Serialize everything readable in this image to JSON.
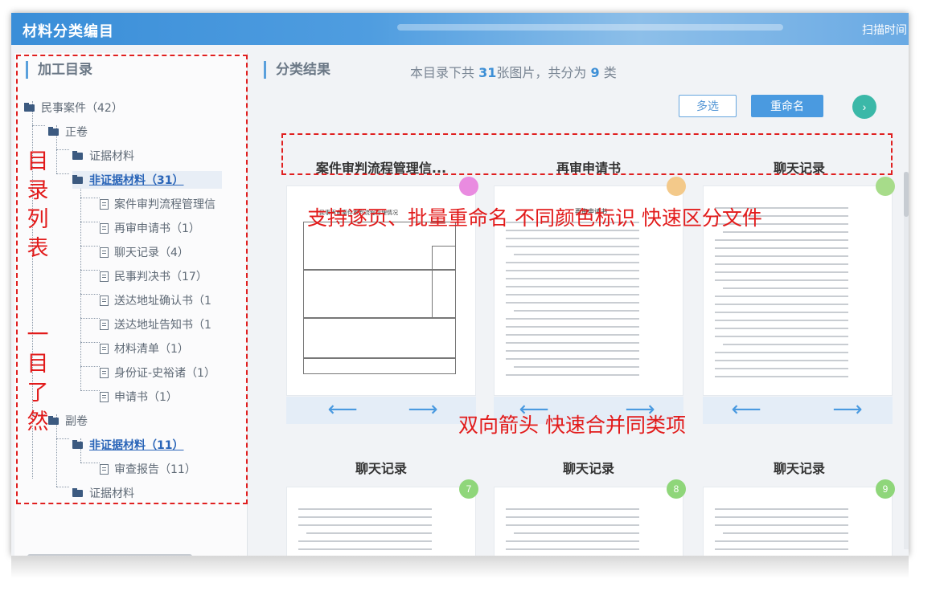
{
  "app": {
    "title": "材料分类编目",
    "scan_time_label": "扫描时间"
  },
  "sidebar": {
    "header": "加工目录",
    "tree": [
      {
        "label": "民事案件（42）",
        "type": "folder",
        "level": 0
      },
      {
        "label": "正卷",
        "type": "folder",
        "level": 1
      },
      {
        "label": "证据材料",
        "type": "folder",
        "level": 2
      },
      {
        "label": "非证据材料（31）",
        "type": "folder",
        "level": 2,
        "selected": true
      },
      {
        "label": "案件审判流程管理信",
        "type": "doc",
        "level": 3
      },
      {
        "label": "再审申请书（1）",
        "type": "doc",
        "level": 3
      },
      {
        "label": "聊天记录（4）",
        "type": "doc",
        "level": 3
      },
      {
        "label": "民事判决书（17）",
        "type": "doc",
        "level": 3
      },
      {
        "label": "送达地址确认书（1",
        "type": "doc",
        "level": 3
      },
      {
        "label": "送达地址告知书（1",
        "type": "doc",
        "level": 3
      },
      {
        "label": "材料清单（1）",
        "type": "doc",
        "level": 3
      },
      {
        "label": "身份证-史裕诸（1）",
        "type": "doc",
        "level": 3
      },
      {
        "label": "申请书（1）",
        "type": "doc",
        "level": 3
      },
      {
        "label": "副卷",
        "type": "folder",
        "level": 1
      },
      {
        "label": "非证据材料（11）",
        "type": "folder",
        "level": 2,
        "selected": true
      },
      {
        "label": "审查报告（11）",
        "type": "doc",
        "level": 3
      },
      {
        "label": "证据材料",
        "type": "folder",
        "level": 2
      }
    ]
  },
  "main": {
    "header": "分类结果",
    "summary_prefix": "本目录下共",
    "summary_count": "31",
    "summary_mid": "张图片，共分为",
    "summary_classes": "9",
    "summary_suffix": "类",
    "btn_multi": "多选",
    "btn_rename": "重命名",
    "btn_next": "›",
    "categories_row1": [
      "案件审判流程管理信...",
      "再审申请书",
      "聊天记录"
    ],
    "categories_row2": [
      "聊天记录",
      "聊天记录",
      "聊天记录"
    ],
    "doc1_title": "民事再审案件审判流程管理情况",
    "doc2_title": "再审申请书",
    "badges_row2": [
      "7",
      "8",
      "9"
    ],
    "badge_colors": [
      "#e98be0",
      "#f3c98a",
      "#a7dc8a",
      "#8fd67a",
      "#8fd67a",
      "#8fd67a"
    ],
    "arrow_left": "⟵",
    "arrow_right": "⟶"
  },
  "annotations": {
    "directory_vertical": "目录列表",
    "at_a_glance_vertical": "一目了然",
    "rename_note": "支持逐页、批量重命名 不同颜色标识  快速区分文件",
    "merge_note": "双向箭头 快速合并同类项"
  }
}
